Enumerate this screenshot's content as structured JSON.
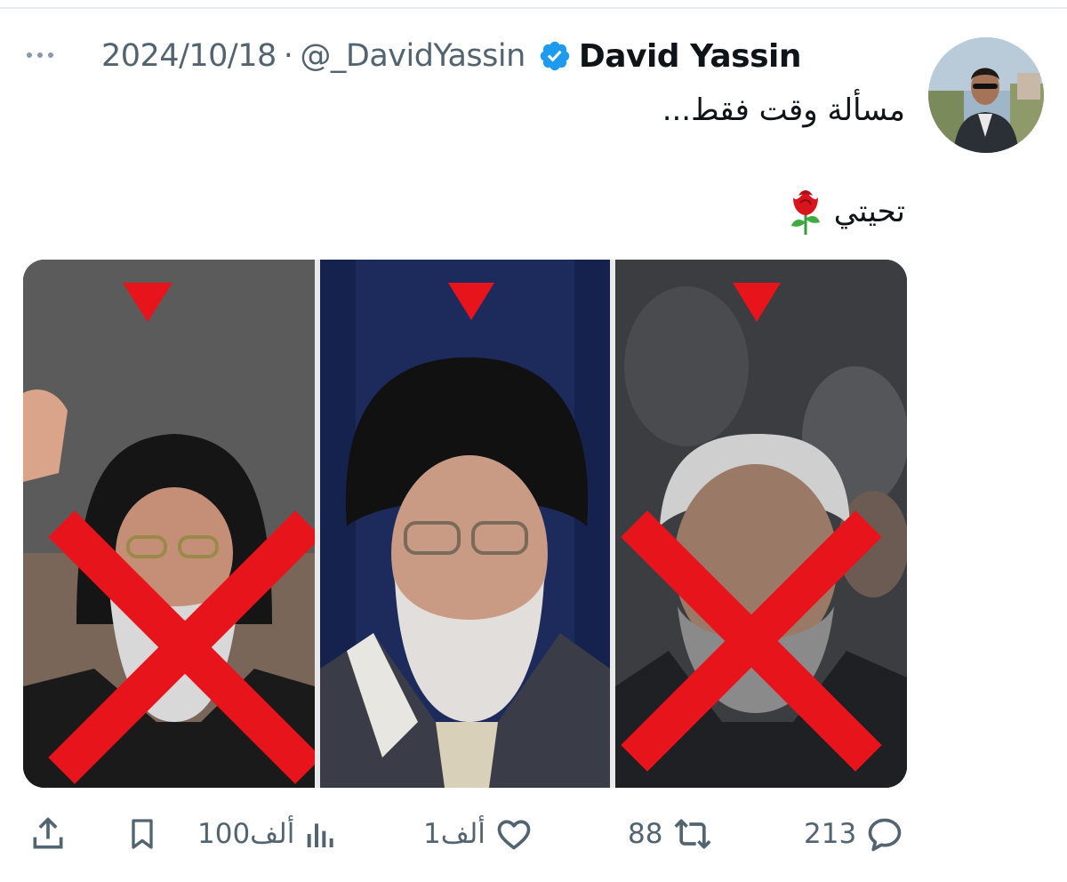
{
  "tweet": {
    "author_name": "David Yassin",
    "handle": "@_DavidYassin",
    "separator": "·",
    "date": "2024/10/18",
    "text_line1": "مسألة وقت فقط...",
    "text_line2": "تحيتي",
    "verified": true
  },
  "icons": {
    "more": "more-horizontal-icon",
    "verified": "verified-badge-icon",
    "rose": "rose-emoji-icon",
    "share": "share-icon",
    "bookmark": "bookmark-icon",
    "views": "views-bar-chart-icon",
    "like": "heart-icon",
    "retweet": "retweet-icon",
    "reply": "reply-bubble-icon"
  },
  "media": {
    "panel_count": 3,
    "crossed_panels": [
      "left",
      "right"
    ],
    "marker": "red-down-triangle",
    "cross_color": "#e8141b"
  },
  "actions": {
    "views": "100ألف",
    "likes": "1ألف",
    "retweets": "88",
    "replies": "213"
  },
  "colors": {
    "accent": "#1d9bf0",
    "muted_text": "#536471",
    "primary_text": "#0f1419",
    "cross_red": "#e8141b"
  }
}
